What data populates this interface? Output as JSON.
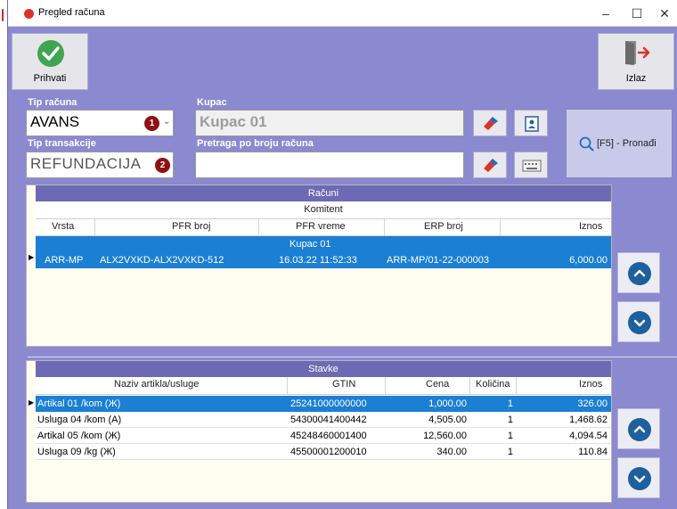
{
  "window": {
    "title": "Pregled računa",
    "minimize": "–",
    "maximize": "☐",
    "close": "✕"
  },
  "toolbar": {
    "accept_label": "Prihvati",
    "exit_label": "Izlaz"
  },
  "form": {
    "tip_racuna_label": "Tip računa",
    "tip_racuna_value": "AVANS",
    "tip_racuna_badge": "1",
    "tip_transakcije_label": "Tip transakcije",
    "tip_transakcije_value": "REFUNDACIJA",
    "tip_transakcije_badge": "2",
    "kupac_label": "Kupac",
    "kupac_value": "Kupac 01",
    "pretraga_label": "Pretraga po broju računa",
    "pretraga_value": "",
    "find_label": "[F5] - Pronađi"
  },
  "racuni": {
    "title": "Računi",
    "group_header": "Komitent",
    "columns": [
      "Vrsta",
      "PFR broj",
      "PFR vreme",
      "ERP broj",
      "Iznos"
    ],
    "group_row": "Kupac 01",
    "rows": [
      {
        "vrsta": "ARR-MP",
        "pfr_broj": "ALX2VXKD-ALX2VXKD-512",
        "pfr_vreme": "16.03.22 11:52:33",
        "erp_broj": "ARR-MP/01-22-000003",
        "iznos": "6,000.00"
      }
    ]
  },
  "stavke": {
    "title": "Stavke",
    "columns": [
      "Naziv artikla/usluge",
      "GTIN",
      "Cena",
      "Količina",
      "Iznos"
    ],
    "rows": [
      {
        "naziv": "Artikal 01 /kom (Ж)",
        "gtin": "25241000000000",
        "cena": "1,000.00",
        "kolicina": "1",
        "iznos": "326.00"
      },
      {
        "naziv": "Usluga 04 /kom (A)",
        "gtin": "54300041400442",
        "cena": "4,505.00",
        "kolicina": "1",
        "iznos": "1,468.62"
      },
      {
        "naziv": "Artikal 05 /kom (Ж)",
        "gtin": "45248460001400",
        "cena": "12,560.00",
        "kolicina": "1",
        "iznos": "4,094.54"
      },
      {
        "naziv": "Usluga 09 /kg (Ж)",
        "gtin": "45500001200010",
        "cena": "340.00",
        "kolicina": "1",
        "iznos": "110.84"
      }
    ]
  },
  "colors": {
    "background": "#8b89cf",
    "header_dark": "#6d6ab5",
    "selection": "#1b7fd4",
    "badge": "#8e1111",
    "accept_green": "#3fa552"
  },
  "icons": {
    "accept": "checkmark-icon",
    "exit": "exit-door-icon",
    "eraser": "eraser-icon",
    "contact_card": "contact-card-icon",
    "keyboard": "keyboard-icon",
    "search": "search-icon",
    "up": "chevron-up-icon",
    "down": "chevron-down-icon"
  }
}
